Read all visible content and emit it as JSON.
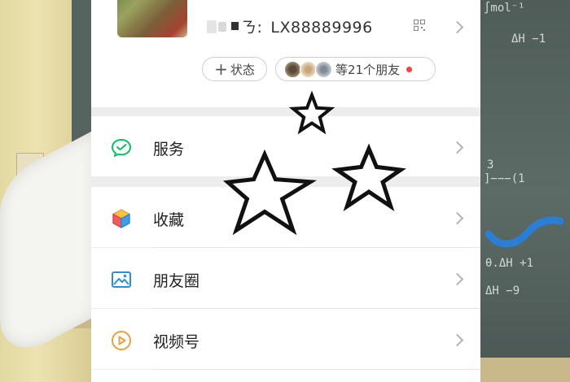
{
  "profile": {
    "wechat_id_label": "ㄋ:",
    "wechat_id_value": "LX88889996",
    "status_button": "状态",
    "friends_text": "等21个朋友"
  },
  "menu": {
    "items": [
      {
        "label": "服务",
        "icon": "wechat-pay-icon"
      },
      {
        "label": "收藏",
        "icon": "cube-icon"
      },
      {
        "label": "朋友圈",
        "icon": "image-icon"
      },
      {
        "label": "视频号",
        "icon": "play-circle-icon"
      }
    ]
  },
  "background": {
    "chalk": [
      "∫mol⁻¹",
      "ΔH  −1",
      "3",
      "]−−−(1",
      "θ.ΔH +1",
      "ΔH  −9"
    ]
  },
  "colors": {
    "wechat_green": "#07c160",
    "collect_icon": "#f5a623",
    "moments_icon": "#2a8fd6",
    "channels_icon": "#e7a13f",
    "notification_dot": "#f24343"
  }
}
